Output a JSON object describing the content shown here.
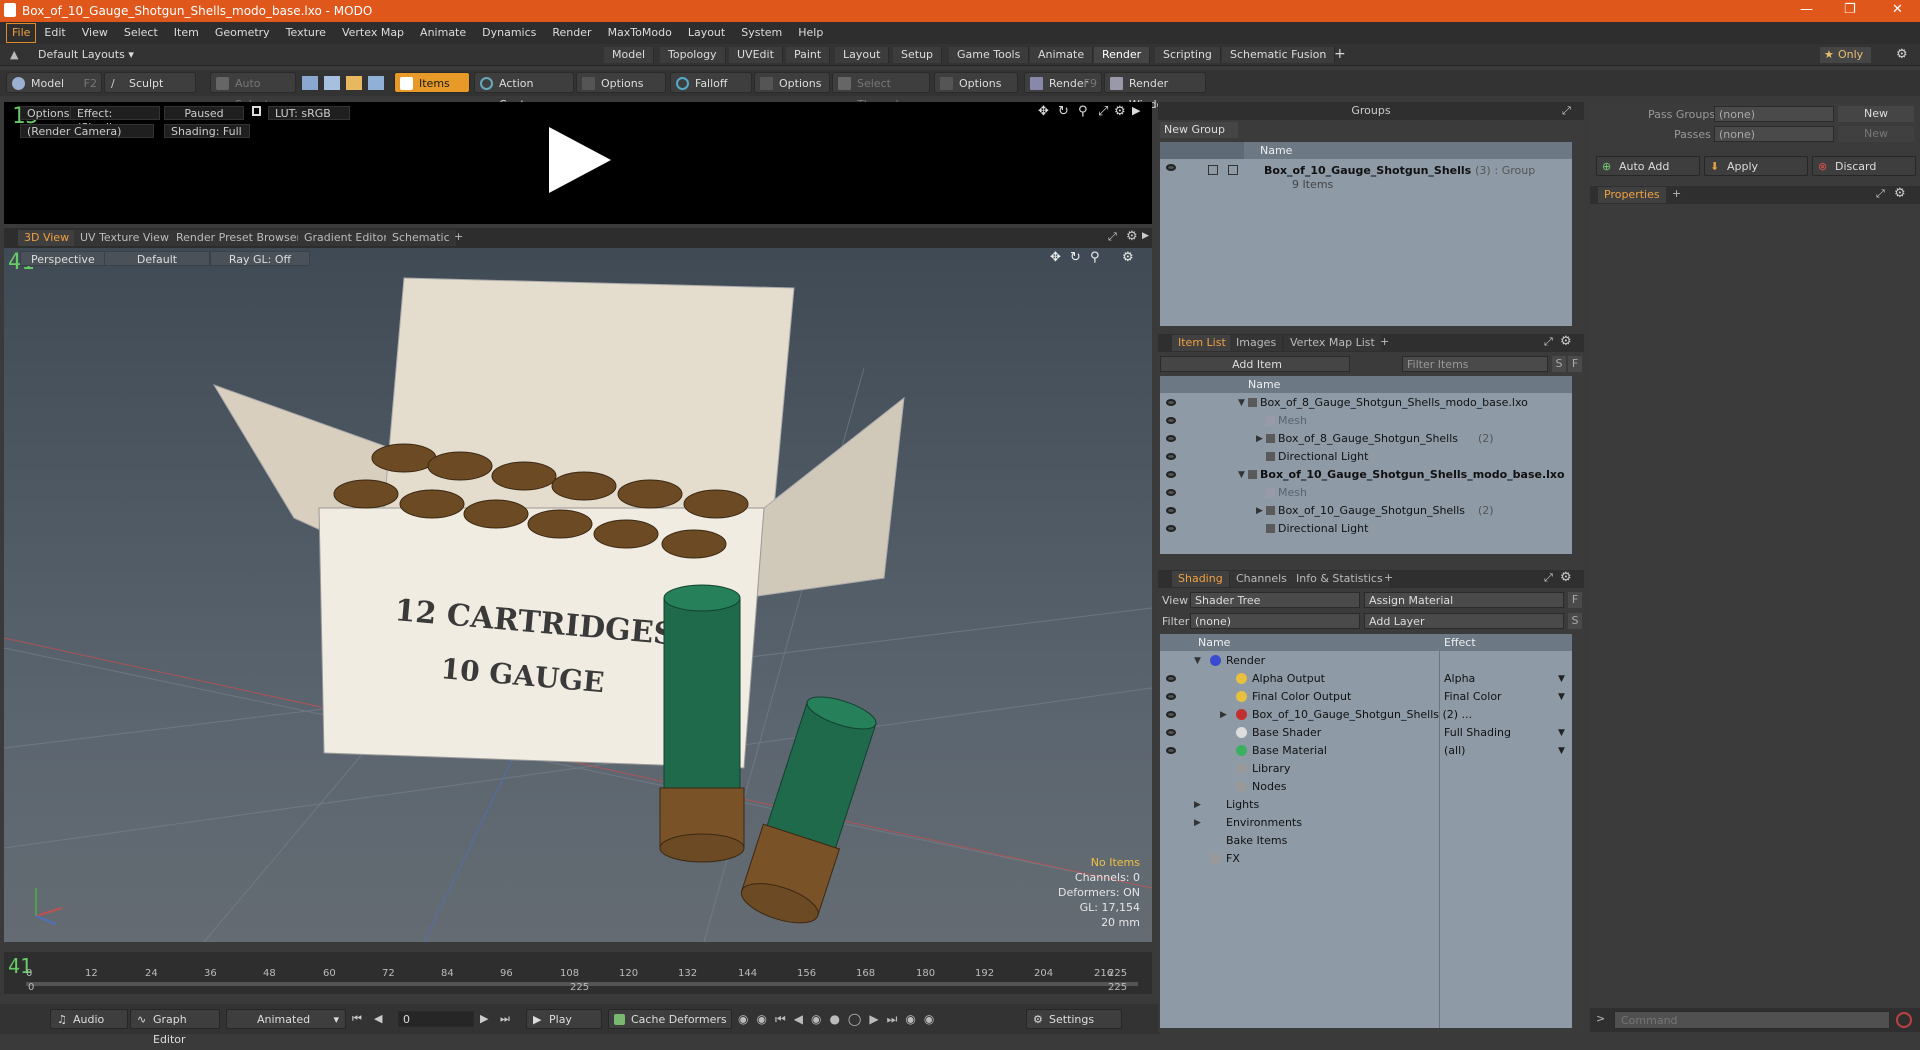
{
  "window": {
    "title": "Box_of_10_Gauge_Shotgun_Shells_modo_base.lxo - MODO"
  },
  "menu": [
    "File",
    "Edit",
    "View",
    "Select",
    "Item",
    "Geometry",
    "Texture",
    "Vertex Map",
    "Animate",
    "Dynamics",
    "Render",
    "MaxToModo",
    "Layout",
    "System",
    "Help"
  ],
  "layout": {
    "preset": "Default Layouts",
    "tabs": [
      "Model",
      "Topology",
      "UVEdit",
      "Paint",
      "Layout",
      "Setup",
      "Game Tools",
      "Animate",
      "Render",
      "Scripting",
      "Schematic Fusion"
    ],
    "active_tab": "Render",
    "add": "+",
    "only": "Only"
  },
  "toolbar": {
    "model": "Model",
    "model_key": "F2",
    "sculpt": "Sculpt",
    "auto_select": "Auto Select",
    "items": "Items",
    "action_center": "Action Center",
    "options1": "Options",
    "falloff": "Falloff",
    "options2": "Options",
    "select_through": "Select Through",
    "options3": "Options",
    "render": "Render",
    "render_key": "F9",
    "render_window": "Render Window"
  },
  "render_view": {
    "options": "Options",
    "effect": "Effect: (Shadi...",
    "paused": "Paused",
    "lut": "LUT: sRGB",
    "camera": "(Render Camera)",
    "shading": "Shading: Full"
  },
  "viewport_tabs": [
    "3D View",
    "UV Texture View",
    "Render Preset Browser",
    "Gradient Editor",
    "Schematic",
    "+"
  ],
  "viewport": {
    "perspective": "Perspective",
    "default": "Default",
    "raygl": "Ray GL: Off",
    "info": {
      "no_items": "No Items",
      "channels": "Channels: 0",
      "deformers": "Deformers: ON",
      "gl": "GL: 17,154",
      "mm": "20 mm"
    },
    "box_text_1": "12 CARTRIDGES",
    "box_text_2": "10 GAUGE"
  },
  "timeline": {
    "ticks": [
      "0",
      "12",
      "24",
      "36",
      "48",
      "60",
      "72",
      "84",
      "96",
      "108",
      "120",
      "132",
      "144",
      "156",
      "168",
      "180",
      "192",
      "204",
      "216"
    ],
    "end_top": "225",
    "start": "0",
    "mid": "225",
    "end_bottom": "225"
  },
  "bottombar": {
    "audio": "Audio",
    "graph_editor": "Graph Editor",
    "animated": "Animated",
    "frame": "0",
    "play": "Play",
    "cache": "Cache Deformers",
    "settings": "Settings"
  },
  "groups": {
    "header": "Groups",
    "new_group": "New Group",
    "col_name": "Name",
    "item_name": "Box_of_10_Gauge_Shotgun_Shells",
    "item_count": "(3)",
    "item_type": ": Group",
    "item_sub": "9 Items"
  },
  "pass": {
    "pass_groups": "Pass Groups",
    "passes": "Passes",
    "none1": "(none)",
    "none2": "(none)",
    "new1": "New",
    "new2": "New",
    "auto_add": "Auto Add",
    "apply": "Apply",
    "discard": "Discard",
    "properties": "Properties"
  },
  "item_list": {
    "tabs": [
      "Item List",
      "Images",
      "Vertex Map List",
      "+"
    ],
    "add_item": "Add Item",
    "filter": "Filter Items",
    "s": "S",
    "f": "F",
    "col_name": "Name",
    "rows": [
      {
        "label": "Box_of_8_Gauge_Shotgun_Shells_modo_base.lxo",
        "indent": 0,
        "bold": false,
        "dim": false
      },
      {
        "label": "Mesh",
        "indent": 1,
        "bold": false,
        "dim": true
      },
      {
        "label": "Box_of_8_Gauge_Shotgun_Shells",
        "count": "(2)",
        "indent": 1,
        "bold": false,
        "dim": false
      },
      {
        "label": "Directional Light",
        "indent": 1,
        "bold": false,
        "dim": false
      },
      {
        "label": "Box_of_10_Gauge_Shotgun_Shells_modo_base.lxo",
        "indent": 0,
        "bold": true,
        "dim": false
      },
      {
        "label": "Mesh",
        "indent": 1,
        "bold": false,
        "dim": true
      },
      {
        "label": "Box_of_10_Gauge_Shotgun_Shells",
        "count": "(2)",
        "indent": 1,
        "bold": false,
        "dim": false
      },
      {
        "label": "Directional Light",
        "indent": 1,
        "bold": false,
        "dim": false
      }
    ]
  },
  "shading": {
    "tabs": [
      "Shading",
      "Channels",
      "Info & Statistics",
      "+"
    ],
    "view_label": "View",
    "view_value": "Shader Tree",
    "assign": "Assign Material",
    "f": "F",
    "filter_label": "Filter",
    "filter_value": "(none)",
    "add_layer": "Add Layer",
    "s": "S",
    "col_name": "Name",
    "col_effect": "Effect",
    "rows": [
      {
        "label": "Render",
        "effect": "",
        "indent": 0
      },
      {
        "label": "Alpha Output",
        "effect": "Alpha",
        "indent": 1
      },
      {
        "label": "Final Color Output",
        "effect": "Final Color",
        "indent": 1
      },
      {
        "label": "Box_of_10_Gauge_Shotgun_Shells (2) ...",
        "effect": "",
        "indent": 1
      },
      {
        "label": "Base Shader",
        "effect": "Full Shading",
        "indent": 1
      },
      {
        "label": "Base Material",
        "effect": "(all)",
        "indent": 1
      },
      {
        "label": "Library",
        "effect": "",
        "indent": 1
      },
      {
        "label": "Nodes",
        "effect": "",
        "indent": 1
      },
      {
        "label": "Lights",
        "effect": "",
        "indent": 0
      },
      {
        "label": "Environments",
        "effect": "",
        "indent": 0
      },
      {
        "label": "Bake Items",
        "effect": "",
        "indent": 0
      },
      {
        "label": "FX",
        "effect": "",
        "indent": 0
      }
    ]
  },
  "command": {
    "placeholder": "Command"
  }
}
